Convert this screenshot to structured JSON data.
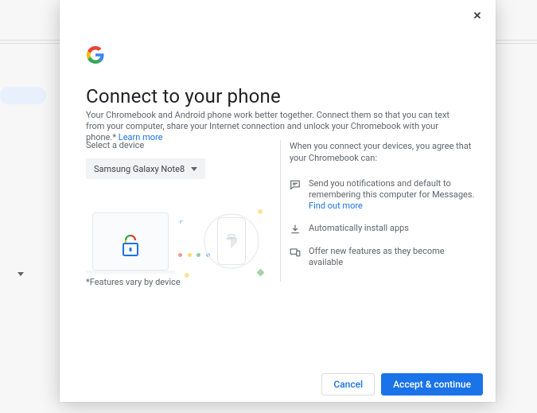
{
  "title": "Connect to your phone",
  "description": "Your Chromebook and Android phone work better together. Connect them so that you can text from your computer, share your Internet connection and unlock your Chromebook with your phone.* ",
  "learn_more": "Learn more",
  "select_label": "Select a device",
  "selected_device": "Samsung Galaxy Note8",
  "footnote": "*Features vary by device",
  "agree_text": "When you connect your devices, you agree that your Chromebook can:",
  "permissions": {
    "p1_text": "Send you notifications and default to remembering this computer for Messages.",
    "p1_link": "Find out more",
    "p2_text": "Automatically install apps",
    "p3_text": "Offer new features as they become available"
  },
  "buttons": {
    "cancel": "Cancel",
    "accept": "Accept & continue"
  }
}
